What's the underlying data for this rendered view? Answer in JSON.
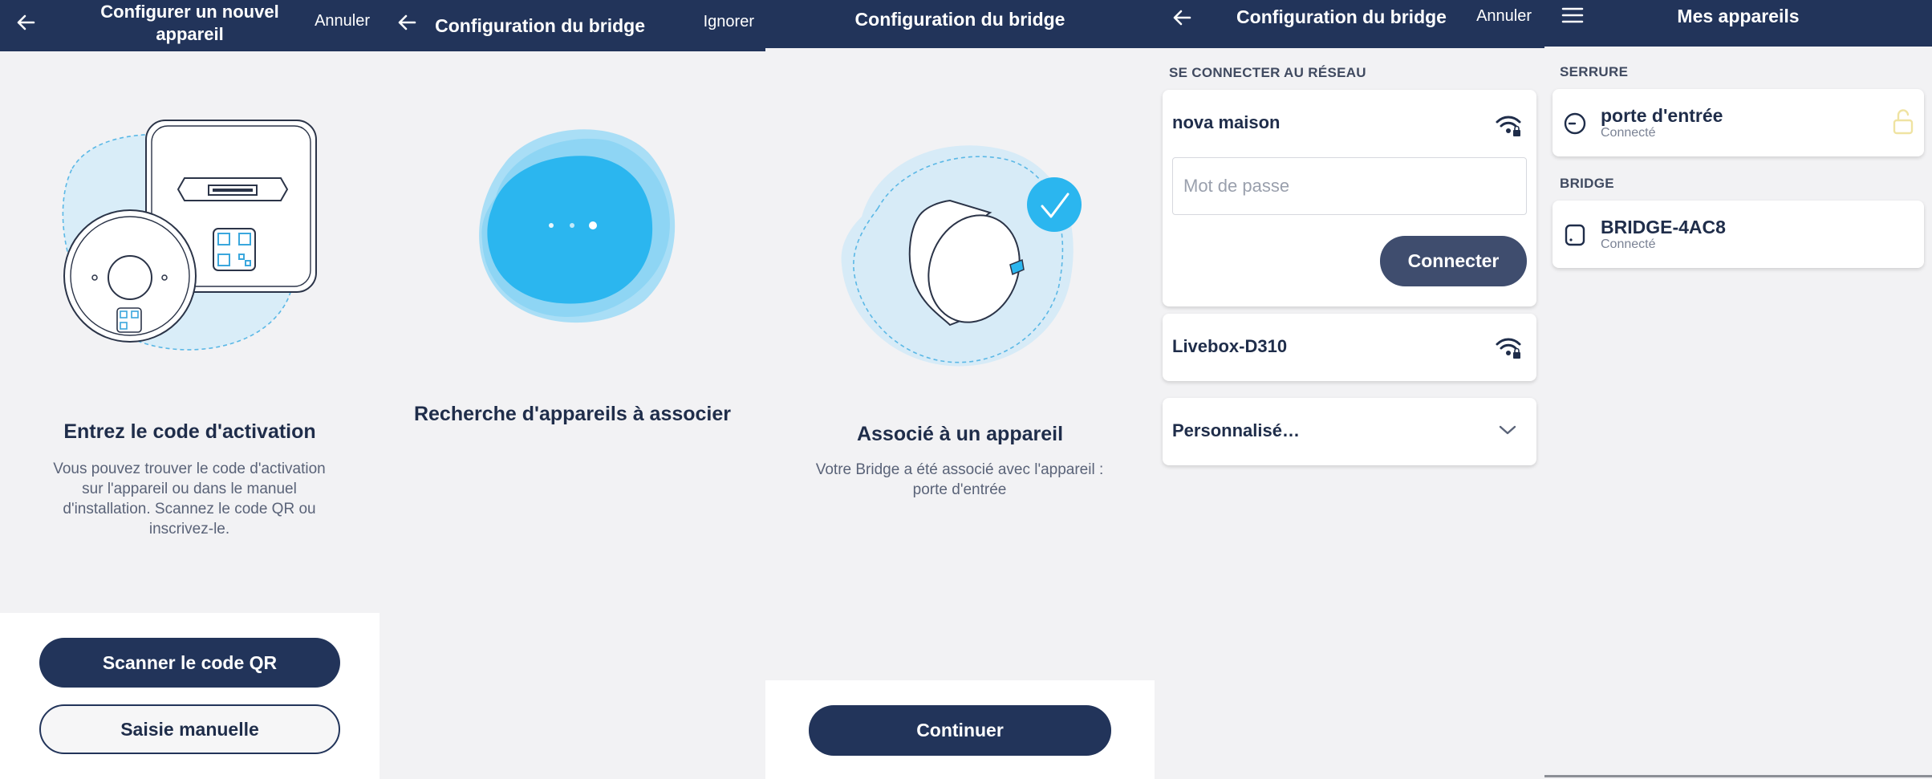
{
  "panel1": {
    "title": "Configurer un nouvel appareil",
    "action": "Annuler",
    "heading": "Entrez le code d'activation",
    "description": "Vous pouvez trouver le code d'activation sur l'appareil ou dans le manuel d'installation. Scannez le code QR ou inscrivez-le.",
    "primary_button": "Scanner le code QR",
    "secondary_button": "Saisie manuelle"
  },
  "panel2": {
    "title": "Configuration du bridge",
    "action": "Ignorer",
    "heading": "Recherche d'appareils à associer"
  },
  "panel3": {
    "title": "Configuration du bridge",
    "heading": "Associé à un appareil",
    "description": "Votre Bridge a été associé avec l'appareil : porte d'entrée",
    "button": "Continuer"
  },
  "panel4": {
    "title": "Configuration du bridge",
    "action": "Annuler",
    "section": "SE CONNECTER AU RÉSEAU",
    "network1": "nova maison",
    "password_placeholder": "Mot de passe",
    "connect_button": "Connecter",
    "network2": "Livebox-D310",
    "custom": "Personnalisé…"
  },
  "panel5": {
    "title": "Mes appareils",
    "section1": "SERRURE",
    "lock_name": "porte d'entrée",
    "lock_status": "Connecté",
    "section2": "BRIDGE",
    "bridge_name": "BRIDGE-4AC8",
    "bridge_status": "Connecté"
  },
  "icons": {
    "back": "arrow-left-icon",
    "menu": "hamburger-menu-icon",
    "wifi": "wifi-lock-icon",
    "chevron": "chevron-down-icon",
    "lock": "unlocked-padlock-icon",
    "check": "checkmark-icon"
  },
  "colors": {
    "header": "#22345a",
    "background": "#f2f2f4",
    "accent_blue": "#2bb6ef",
    "light_blue": "#bfe6f8"
  }
}
